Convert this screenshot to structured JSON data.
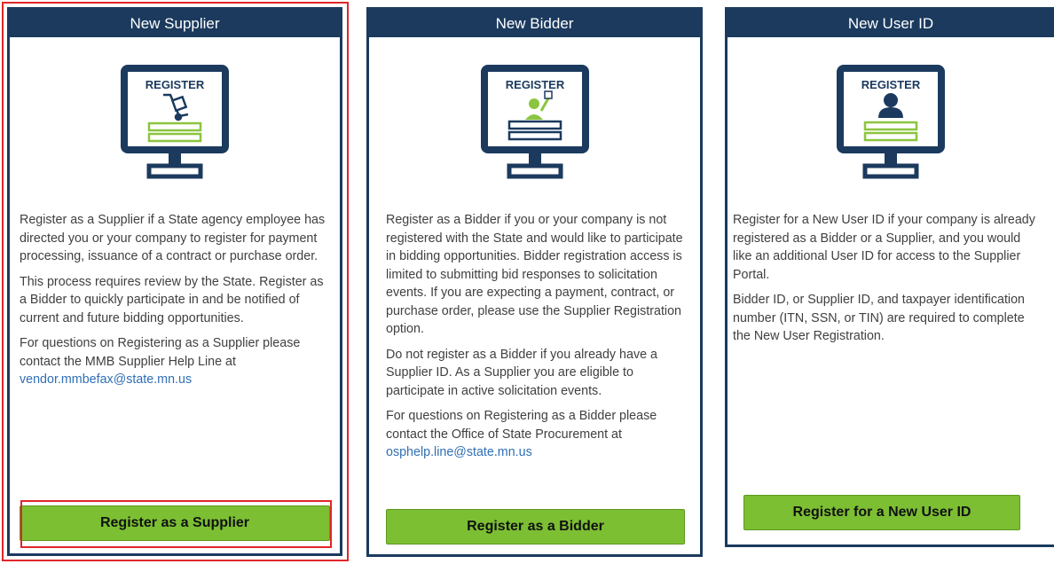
{
  "cards": [
    {
      "title": "New Supplier",
      "icon": "register-supplier-monitor-icon",
      "icon_text": "REGISTER",
      "paragraphs": [
        "Register as a Supplier if a State agency employee has directed you or your company to register for payment processing, issuance of a contract or purchase order.",
        "This process requires review by the State. Register as a Bidder to quickly participate in and be notified of current and future bidding opportunities.",
        "For questions on Registering as a Supplier please contact the MMB Supplier Help Line at"
      ],
      "email": "vendor.mmbefax@state.mn.us",
      "button_label": "Register as a Supplier",
      "selected": true
    },
    {
      "title": "New Bidder",
      "icon": "register-bidder-monitor-icon",
      "icon_text": "REGISTER",
      "paragraphs": [
        "Register as a Bidder if you or your company is not registered with the State and would like to participate in bidding opportunities.  Bidder registration access is limited to submitting bid responses to solicitation events.  If you are expecting a payment, contract, or purchase order, please use the Supplier Registration option.",
        "Do not register as a Bidder if you already have a Supplier ID. As a Supplier you are eligible to participate in active solicitation events.",
        "For questions on Registering as a Bidder please contact the Office of State Procurement at"
      ],
      "email": "osphelp.line@state.mn.us",
      "button_label": "Register as a Bidder"
    },
    {
      "title": "New User ID",
      "icon": "register-user-monitor-icon",
      "icon_text": "REGISTER",
      "paragraphs": [
        "Register for a New User ID if your company is already registered as a Bidder or a Supplier, and you would like an additional User ID for access to the Supplier Portal.",
        "Bidder ID, or Supplier ID, and taxpayer identification number (ITN, SSN, or TIN) are required to complete the New User Registration."
      ],
      "email": "",
      "button_label": "Register for a New User ID"
    }
  ],
  "colors": {
    "navy": "#1b3a5e",
    "green": "#7cbf33",
    "highlight": "#e0262a",
    "link": "#2f6fb5"
  }
}
